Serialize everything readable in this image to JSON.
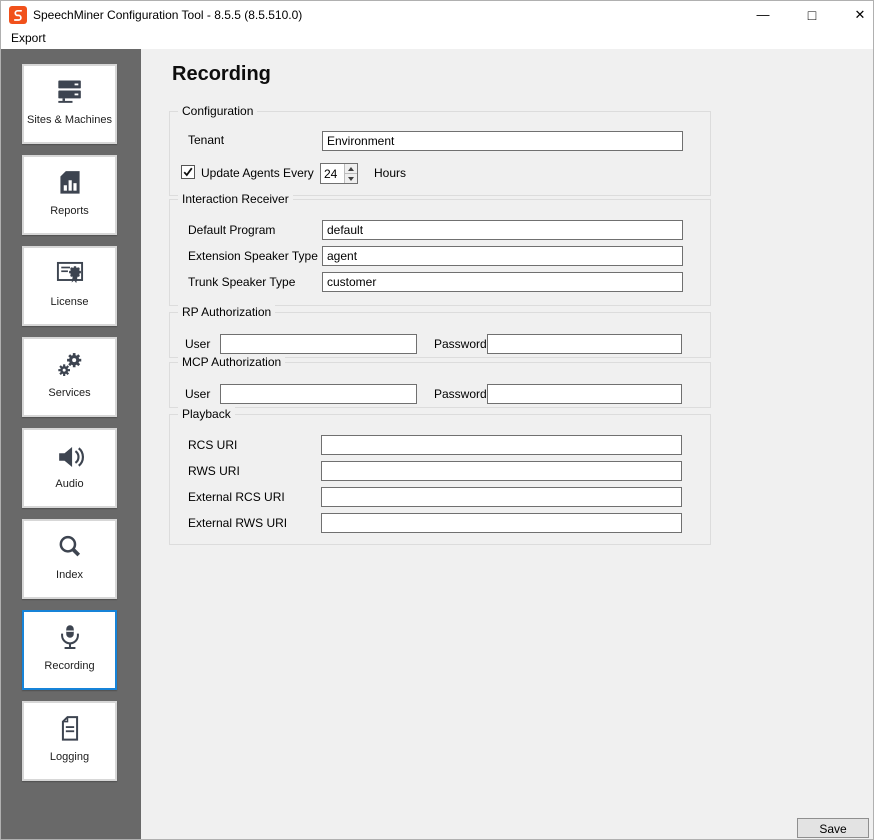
{
  "window": {
    "title": "SpeechMiner Configuration Tool - 8.5.5 (8.5.510.0)",
    "controls": {
      "minimize": "—",
      "maximize": "□",
      "close": "✕"
    }
  },
  "menu": {
    "export_label": "Export"
  },
  "sidebar": {
    "items": [
      {
        "label": "Sites & Machines",
        "icon": "servers-icon",
        "selected": false
      },
      {
        "label": "Reports",
        "icon": "bar-chart-document-icon",
        "selected": false
      },
      {
        "label": "License",
        "icon": "certificate-icon",
        "selected": false
      },
      {
        "label": "Services",
        "icon": "gears-icon",
        "selected": false
      },
      {
        "label": "Audio",
        "icon": "speaker-icon",
        "selected": false
      },
      {
        "label": "Index",
        "icon": "magnifier-icon",
        "selected": false
      },
      {
        "label": "Recording",
        "icon": "microphone-icon",
        "selected": true
      },
      {
        "label": "Logging",
        "icon": "document-lines-icon",
        "selected": false
      }
    ]
  },
  "main": {
    "title": "Recording",
    "configuration": {
      "legend": "Configuration",
      "tenant_label": "Tenant",
      "tenant_value": "Environment",
      "update_agents_label": "Update Agents Every",
      "update_agents_checked": true,
      "interval_value": "24",
      "hours_label": "Hours"
    },
    "interaction_receiver": {
      "legend": "Interaction Receiver",
      "rows": [
        {
          "label": "Default Program",
          "value": "default"
        },
        {
          "label": "Extension Speaker Type",
          "value": "agent"
        },
        {
          "label": "Trunk Speaker Type",
          "value": "customer"
        }
      ]
    },
    "rp_authorization": {
      "legend": "RP Authorization",
      "user_label": "User",
      "user_value": "",
      "password_label": "Password",
      "password_value": ""
    },
    "mcp_authorization": {
      "legend": "MCP Authorization",
      "user_label": "User",
      "user_value": "",
      "password_label": "Password",
      "password_value": ""
    },
    "playback": {
      "legend": "Playback",
      "rows": [
        {
          "label": "RCS URI",
          "value": ""
        },
        {
          "label": "RWS URI",
          "value": ""
        },
        {
          "label": "External RCS URI",
          "value": ""
        },
        {
          "label": "External RWS URI",
          "value": ""
        }
      ]
    },
    "save_button_label": "Save"
  },
  "colors": {
    "sidebar_bg": "#696969",
    "main_bg": "#f0f0f0",
    "selected_tile_border": "#1683d8",
    "icon_color": "#3d4450",
    "logo_orange": "#f1511b",
    "input_border": "#707070",
    "groupbox_border": "#dcdcdc"
  }
}
